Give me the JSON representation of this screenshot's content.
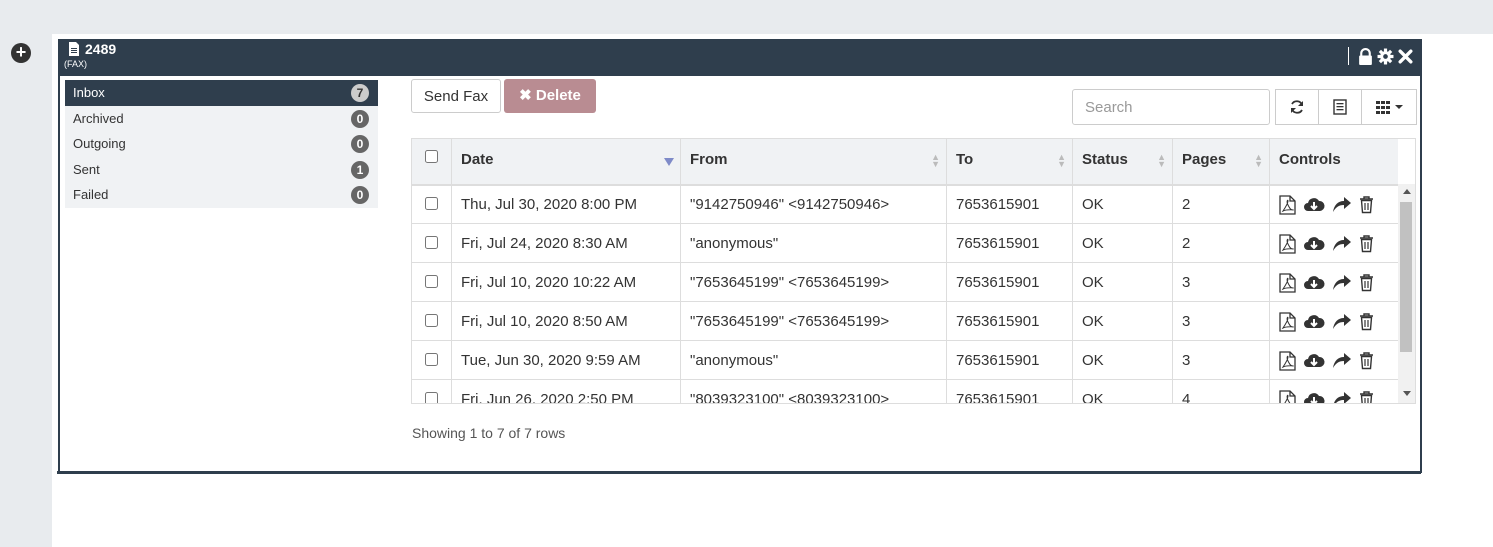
{
  "header": {
    "title": "2489",
    "subtitle": "(FAX)",
    "icons": [
      "fax-doc-icon",
      "lock-icon",
      "gear-icon",
      "close-icon"
    ]
  },
  "add_button": {
    "label": "+"
  },
  "sidebar": {
    "items": [
      {
        "label": "Inbox",
        "count": "7",
        "active": true
      },
      {
        "label": "Archived",
        "count": "0"
      },
      {
        "label": "Outgoing",
        "count": "0"
      },
      {
        "label": "Sent",
        "count": "1"
      },
      {
        "label": "Failed",
        "count": "0"
      }
    ]
  },
  "toolbar": {
    "send_fax": "Send Fax",
    "delete": "Delete",
    "search_placeholder": "Search"
  },
  "table": {
    "columns": [
      "Date",
      "From",
      "To",
      "Status",
      "Pages",
      "Controls"
    ],
    "sorted_column": "Date",
    "rows": [
      {
        "date": "Thu, Jul 30, 2020 8:00 PM",
        "from": "\"9142750946\" <9142750946>",
        "to": "7653615901",
        "status": "OK",
        "pages": "2"
      },
      {
        "date": "Fri, Jul 24, 2020 8:30 AM",
        "from": "\"anonymous\"",
        "to": "7653615901",
        "status": "OK",
        "pages": "2"
      },
      {
        "date": "Fri, Jul 10, 2020 10:22 AM",
        "from": "\"7653645199\" <7653645199>",
        "to": "7653615901",
        "status": "OK",
        "pages": "3"
      },
      {
        "date": "Fri, Jul 10, 2020 8:50 AM",
        "from": "\"7653645199\" <7653645199>",
        "to": "7653615901",
        "status": "OK",
        "pages": "3"
      },
      {
        "date": "Tue, Jun 30, 2020 9:59 AM",
        "from": "\"anonymous\"",
        "to": "7653615901",
        "status": "OK",
        "pages": "3"
      },
      {
        "date": "Fri, Jun 26, 2020 2:50 PM",
        "from": "\"8039323100\" <8039323100>",
        "to": "7653615901",
        "status": "OK",
        "pages": "4"
      }
    ]
  },
  "footer": {
    "text": "Showing 1 to 7 of 7 rows"
  },
  "colors": {
    "header_bg": "#2f3e4d",
    "delete_bg": "#b98c92",
    "sort_active": "#7f8bc8"
  }
}
